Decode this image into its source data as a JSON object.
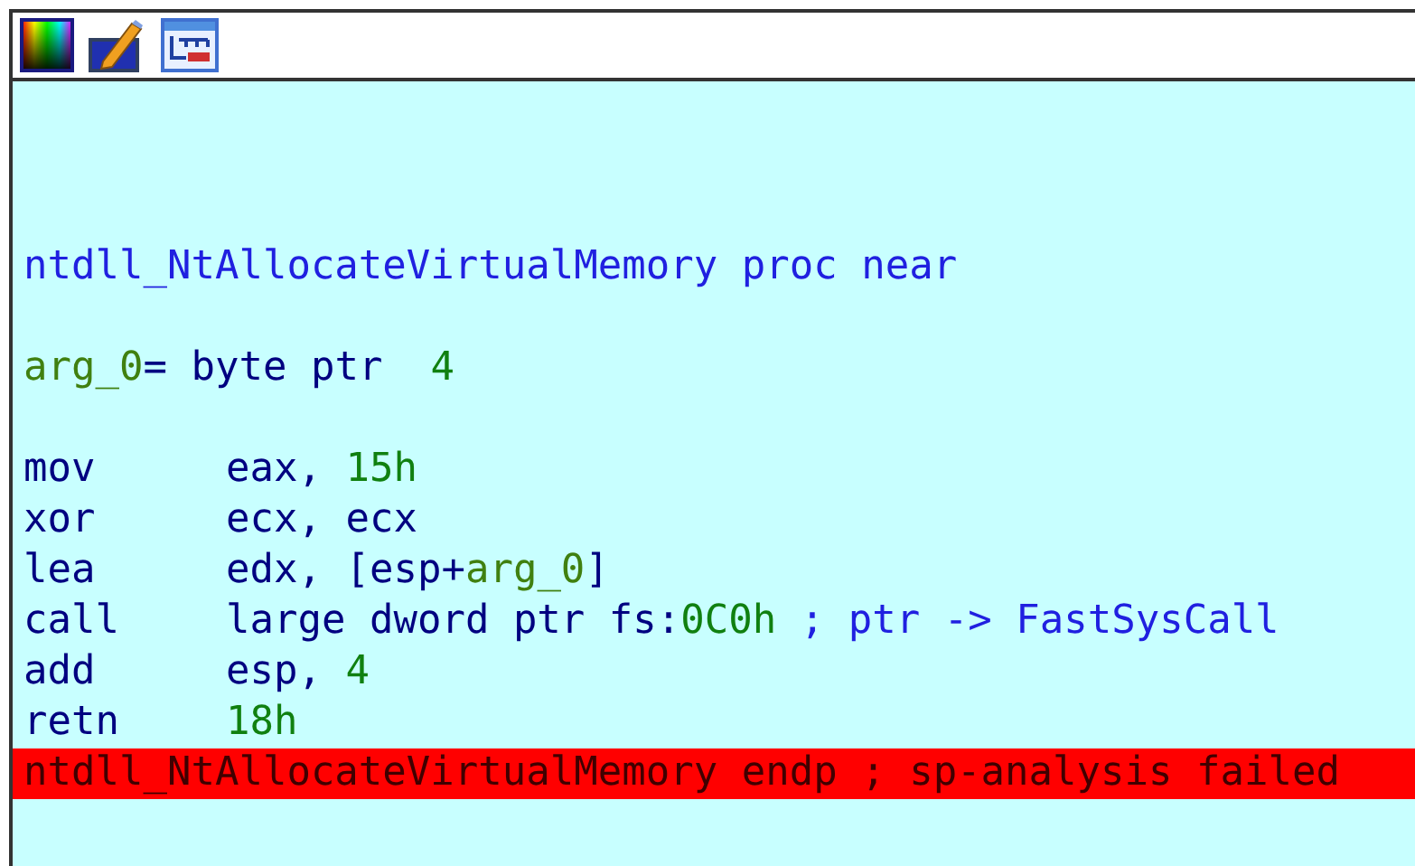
{
  "toolbar": {
    "icons": [
      {
        "kind": "palette"
      },
      {
        "kind": "edit"
      },
      {
        "kind": "graph"
      }
    ]
  },
  "listing": {
    "lines": [
      {
        "kind": "blank"
      },
      {
        "kind": "blank"
      },
      {
        "kind": "blank"
      },
      {
        "kind": "text",
        "highlighted": false,
        "segments": [
          {
            "kind": "name",
            "text": "ntdll_NtAllocateVirtualMemory proc near"
          }
        ]
      },
      {
        "kind": "blank"
      },
      {
        "kind": "text",
        "highlighted": false,
        "segments": [
          {
            "kind": "label",
            "text": "arg_0"
          },
          {
            "kind": "plain",
            "text": "= byte ptr  "
          },
          {
            "kind": "number",
            "text": "4"
          }
        ]
      },
      {
        "kind": "blank"
      },
      {
        "kind": "instruction",
        "highlighted": false,
        "mnemonic": "mov",
        "segments": [
          {
            "kind": "plain",
            "text": "eax, "
          },
          {
            "kind": "number",
            "text": "15h"
          }
        ]
      },
      {
        "kind": "instruction",
        "highlighted": false,
        "mnemonic": "xor",
        "segments": [
          {
            "kind": "plain",
            "text": "ecx, ecx"
          }
        ]
      },
      {
        "kind": "instruction",
        "highlighted": false,
        "mnemonic": "lea",
        "segments": [
          {
            "kind": "plain",
            "text": "edx, [esp+"
          },
          {
            "kind": "label",
            "text": "arg_0"
          },
          {
            "kind": "plain",
            "text": "]"
          }
        ]
      },
      {
        "kind": "instruction",
        "highlighted": false,
        "mnemonic": "call",
        "segments": [
          {
            "kind": "plain",
            "text": "large dword ptr fs:"
          },
          {
            "kind": "number",
            "text": "0C0h"
          },
          {
            "kind": "comment",
            "text": " ; ptr -> FastSysCall"
          }
        ]
      },
      {
        "kind": "instruction",
        "highlighted": false,
        "mnemonic": "add",
        "segments": [
          {
            "kind": "plain",
            "text": "esp, "
          },
          {
            "kind": "number",
            "text": "4"
          }
        ]
      },
      {
        "kind": "instruction",
        "highlighted": false,
        "mnemonic": "retn",
        "segments": [
          {
            "kind": "number",
            "text": "18h"
          }
        ]
      },
      {
        "kind": "text",
        "highlighted": true,
        "segments": [
          {
            "kind": "plain",
            "text": "ntdll_NtAllocateVirtualMemory endp ; sp-analysis failed"
          }
        ]
      }
    ]
  }
}
